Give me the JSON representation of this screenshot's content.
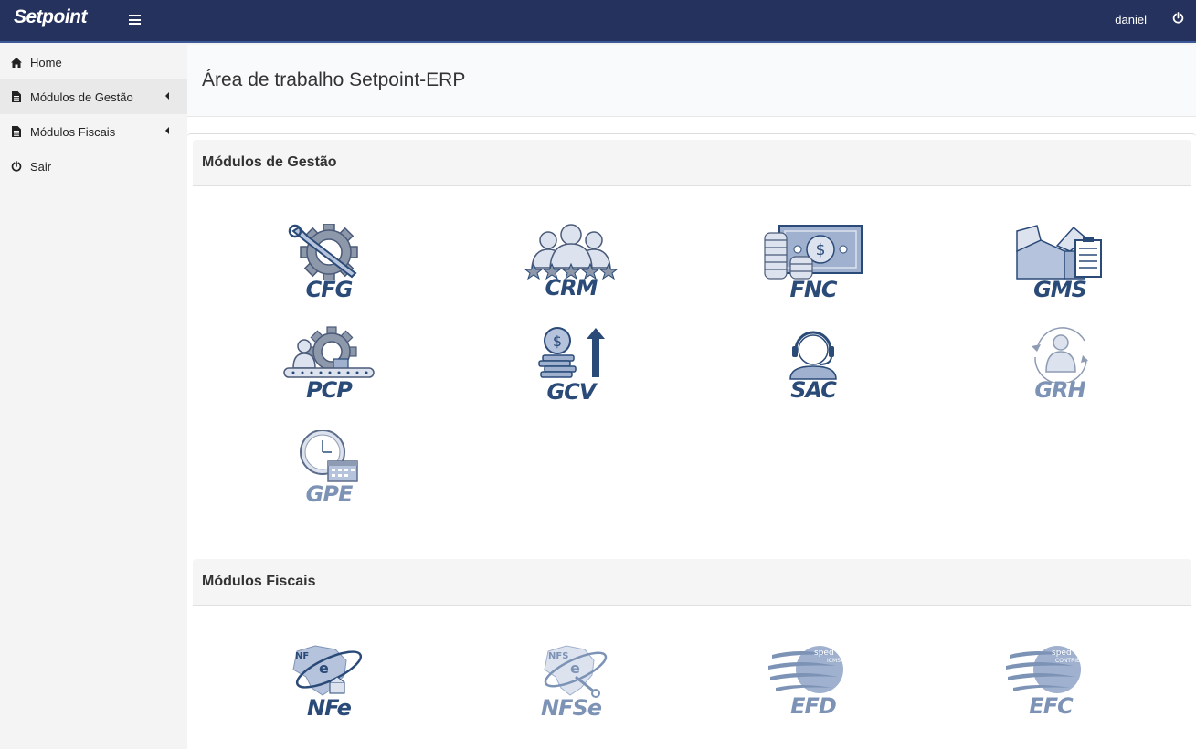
{
  "app": {
    "brand": "Setpoint",
    "user": "daniel"
  },
  "sidebar": {
    "items": [
      {
        "label": "Home",
        "icon": "home-icon"
      },
      {
        "label": "Módulos de Gestão",
        "icon": "document-icon"
      },
      {
        "label": "Módulos Fiscais",
        "icon": "document-icon"
      },
      {
        "label": "Sair",
        "icon": "power-icon"
      }
    ]
  },
  "page": {
    "title": "Área de trabalho Setpoint-ERP"
  },
  "sections": {
    "gestao": {
      "title": "Módulos de Gestão",
      "modules": [
        {
          "code": "CFG",
          "icon": "gear-wrench-icon"
        },
        {
          "code": "CRM",
          "icon": "people-stars-icon"
        },
        {
          "code": "FNC",
          "icon": "money-coins-icon"
        },
        {
          "code": "GMS",
          "icon": "boxes-checklist-icon"
        },
        {
          "code": "PCP",
          "icon": "gear-conveyor-icon"
        },
        {
          "code": "GCV",
          "icon": "coins-arrow-icon"
        },
        {
          "code": "SAC",
          "icon": "headset-agent-icon"
        },
        {
          "code": "GRH",
          "icon": "person-cycle-icon"
        },
        {
          "code": "GPE",
          "icon": "clock-calendar-icon"
        }
      ]
    },
    "fiscais": {
      "title": "Módulos Fiscais",
      "modules": [
        {
          "code": "NFe",
          "icon": "nfe-map-icon",
          "badge": "NF"
        },
        {
          "code": "NFSe",
          "icon": "nfse-map-icon",
          "badge": "NFS"
        },
        {
          "code": "EFD",
          "icon": "sped-globe-icon",
          "badge": "sped",
          "sub": "ICMS/IPI"
        },
        {
          "code": "EFC",
          "icon": "sped-globe-icon",
          "badge": "sped",
          "sub": "CONTRIBUIÇÕES"
        }
      ]
    }
  }
}
